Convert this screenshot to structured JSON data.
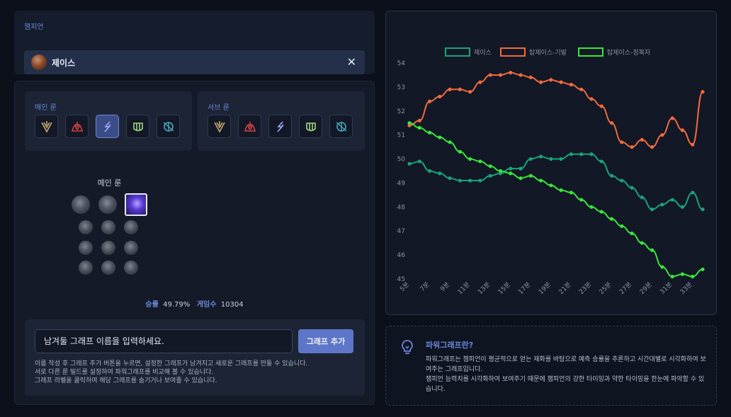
{
  "champion_section": {
    "label": "챔피언",
    "selected": "제이스",
    "clear_icon": "close-icon"
  },
  "runes": {
    "main_label": "메인 룬",
    "sub_label": "서브 룬",
    "trees": [
      {
        "name": "precision-icon",
        "color": "#c8aa6e"
      },
      {
        "name": "domination-icon",
        "color": "#d44242"
      },
      {
        "name": "sorcery-icon",
        "color": "#9faafc"
      },
      {
        "name": "resolve-icon",
        "color": "#a1d586"
      },
      {
        "name": "inspiration-icon",
        "color": "#49aab9"
      }
    ],
    "main_active_index": 2,
    "detail_title": "메인 룬"
  },
  "stats": {
    "winrate_label": "승률",
    "winrate_value": "49.79%",
    "games_label": "게임수",
    "games_value": "10304"
  },
  "graph_input": {
    "placeholder": "남겨둘 그래프 이름을 입력하세요.",
    "add_button": "그래프 추가",
    "help_lines": [
      "이름 작성 후 그래프 추가 버튼을 누르면, 설정한 그래프가 남겨지고 새로운 그래프를 만들 수 있습니다.",
      "서로 다른 룬 빌드를 설정하여 파워그래프를 비교해 볼 수 있습니다.",
      "그래프 라벨을 클릭하여 해당 그래프를 숨기거나 보여줄 수 있습니다."
    ]
  },
  "info": {
    "title": "파워그래프란?",
    "lines": [
      "파워그래프는 챔피언이 평균적으로 얻는 재화를 바탕으로 예측 승률을 추론하고 시간대별로 시각화하여 보여주는 그래프입니다.",
      "챔피언 능력치를 시각화하여 보여주기 때문에 챔피언의 강한 타이밍과 약한 타이밍을 한눈에 파악할 수 있습니다."
    ]
  },
  "chart_data": {
    "type": "line",
    "x": [
      5,
      6,
      7,
      8,
      9,
      10,
      11,
      12,
      13,
      14,
      15,
      16,
      17,
      18,
      19,
      20,
      21,
      22,
      23,
      24,
      25,
      26,
      27,
      28,
      29,
      30,
      31,
      32,
      33,
      34
    ],
    "x_tick_labels": [
      "5분",
      "7분",
      "9분",
      "11분",
      "13분",
      "15분",
      "17분",
      "19분",
      "21분",
      "23분",
      "25분",
      "27분",
      "29분",
      "31분",
      "33분"
    ],
    "ylim": [
      45,
      54
    ],
    "y_ticks": [
      45,
      46,
      47,
      48,
      49,
      50,
      51,
      52,
      53,
      54
    ],
    "grid": false,
    "legend_position": "top",
    "series": [
      {
        "name": "제이스",
        "color": "#1aa37a",
        "values": [
          49.8,
          49.9,
          49.5,
          49.4,
          49.2,
          49.1,
          49.1,
          49.1,
          49.3,
          49.4,
          49.6,
          49.6,
          50.0,
          50.1,
          50.0,
          50.0,
          50.2,
          50.2,
          50.2,
          49.9,
          49.3,
          49.1,
          48.8,
          48.4,
          47.9,
          48.1,
          48.3,
          48.0,
          48.6,
          47.9
        ]
      },
      {
        "name": "탑제이스-기발",
        "color": "#f26a3d",
        "values": [
          51.4,
          51.6,
          52.4,
          52.6,
          52.9,
          52.9,
          52.8,
          53.2,
          53.5,
          53.5,
          53.6,
          53.5,
          53.4,
          53.2,
          53.3,
          53.2,
          53.1,
          52.9,
          52.5,
          52.2,
          51.5,
          50.7,
          50.5,
          50.8,
          50.5,
          51.0,
          51.7,
          51.2,
          50.6,
          52.8
        ]
      },
      {
        "name": "탑제이스-정복자",
        "color": "#39e63a",
        "values": [
          51.5,
          51.3,
          51.1,
          50.9,
          50.7,
          50.3,
          50.0,
          49.9,
          49.7,
          49.5,
          49.4,
          49.2,
          49.3,
          49.1,
          48.9,
          48.7,
          48.6,
          48.3,
          48.0,
          47.8,
          47.5,
          47.2,
          46.9,
          46.5,
          46.2,
          45.5,
          45.1,
          45.2,
          45.1,
          45.4
        ]
      }
    ]
  }
}
